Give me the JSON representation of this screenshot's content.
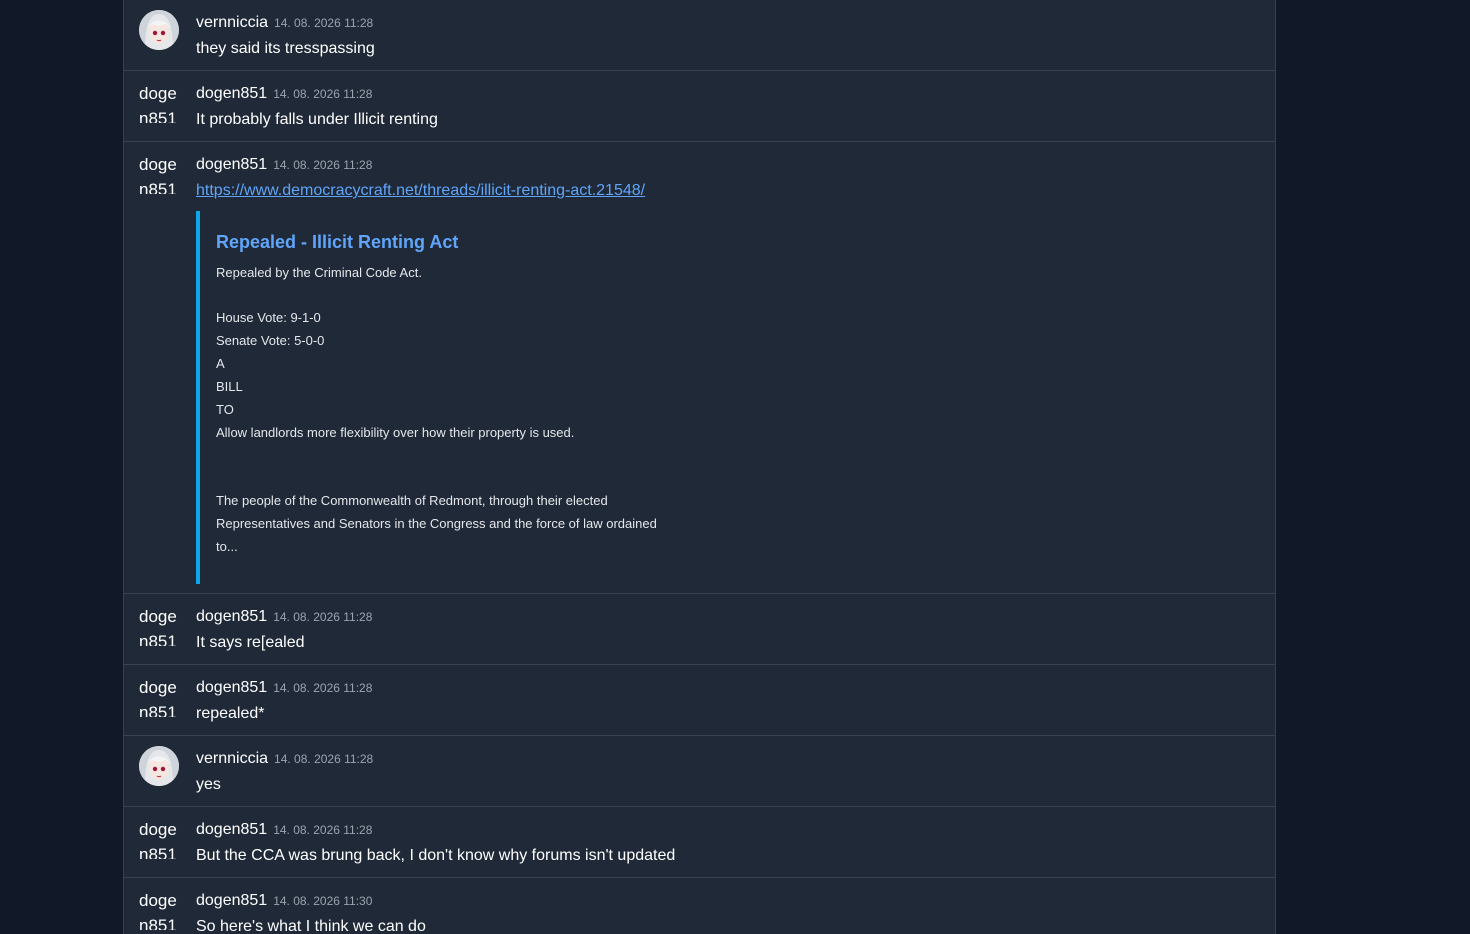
{
  "messages": [
    {
      "author": "vernniccia",
      "time": "14. 08. 2026 11:28",
      "text": "they said its tresspassing"
    },
    {
      "author": "dogen851",
      "avatar_alt": "dogen851 avatar",
      "time": "14. 08. 2026 11:28",
      "text": "It probably falls under Illicit renting"
    },
    {
      "author": "dogen851",
      "avatar_alt": "dogen851 avatar",
      "time": "14. 08. 2026 11:28",
      "link": "https://www.democracycraft.net/threads/illicit-renting-act.21548/",
      "embed": {
        "title": "Repealed - Illicit Renting Act",
        "lines": [
          "Repealed by the Criminal Code Act.",
          "House Vote: 9-1-0",
          "Senate Vote: 5-0-0",
          "A",
          "BILL",
          "TO",
          "Allow landlords more flexibility over how their property is used.",
          "The people of the Commonwealth of Redmont, through their elected",
          "Representatives and Senators in the Congress and the force of law ordained",
          "to..."
        ]
      }
    },
    {
      "author": "dogen851",
      "avatar_alt": "dogen851 avatar",
      "time": "14. 08. 2026 11:28",
      "text": "It says re[ealed"
    },
    {
      "author": "dogen851",
      "avatar_alt": "dogen851 avatar",
      "time": "14. 08. 2026 11:28",
      "text": "repealed*"
    },
    {
      "author": "vernniccia",
      "time": "14. 08. 2026 11:28",
      "text": "yes"
    },
    {
      "author": "dogen851",
      "avatar_alt": "dogen851 avatar",
      "time": "14. 08. 2026 11:28",
      "text": "But the CCA was brung back, I don't know why forums isn't updated"
    },
    {
      "author": "dogen851",
      "avatar_alt": "dogen851 avatar",
      "time": "14. 08. 2026 11:30",
      "text": "So here's what I think we can do"
    }
  ],
  "colors": {
    "background": "#111827",
    "panel": "#1f2937",
    "link": "#60a5fa",
    "embed_accent": "#0ea5e9"
  },
  "icons": {
    "avatar_vernniccia": "anime-avatar-icon"
  }
}
